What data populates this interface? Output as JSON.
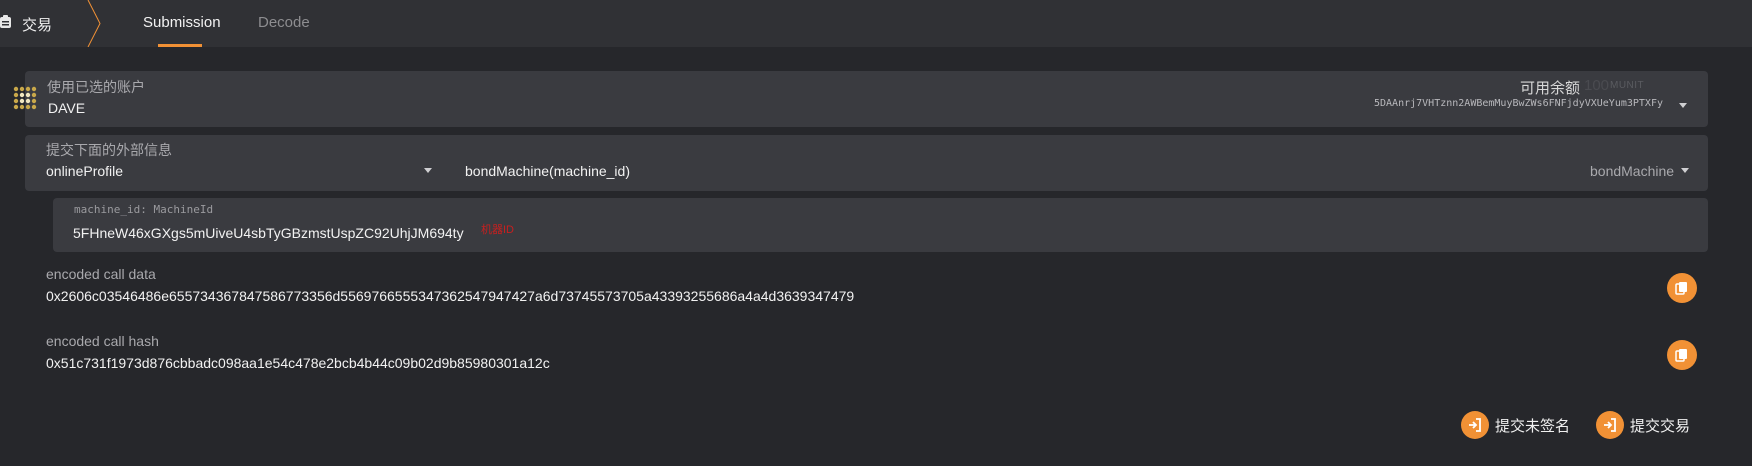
{
  "header": {
    "app_title": "交易",
    "tabs": [
      {
        "label": "Submission",
        "active": true
      },
      {
        "label": "Decode",
        "active": false
      }
    ]
  },
  "account": {
    "label": "使用已选的账户",
    "name": "DAVE",
    "balance_label": "可用余额",
    "balance_value": "100",
    "balance_unit": "MUNIT",
    "address": "5DAAnrj7VHTznn2AWBemMuyBwZWs6FNFjdyVXUeYum3PTXFy"
  },
  "extrinsic": {
    "label": "提交下面的外部信息",
    "module": "onlineProfile",
    "call_signature": "bondMachine(machine_id)",
    "method": "bondMachine"
  },
  "param": {
    "label": "machine_id: MachineId",
    "value": "5FHneW46xGXgs5mUiveU4sbTyGBzmstUspZC92UhjJM694ty",
    "hint": "机器ID"
  },
  "encoded_data": {
    "label": "encoded call data",
    "value": "0x2606c03546486e65573436784758677335​6d556976655534736254794742​7a6d73745573705a43393255686a4a4d3639347479"
  },
  "encoded_hash": {
    "label": "encoded call hash",
    "value": "0x51c731f1973d876cbbadc098aa1e54c478e2bcb4b44c09b02d9b85980301a12c"
  },
  "actions": {
    "unsigned": "提交未签名",
    "submit": "提交交易"
  },
  "colors": {
    "accent": "#f19135",
    "background": "#26272b",
    "panel": "#3a3b40",
    "hint": "#c81f1f"
  }
}
